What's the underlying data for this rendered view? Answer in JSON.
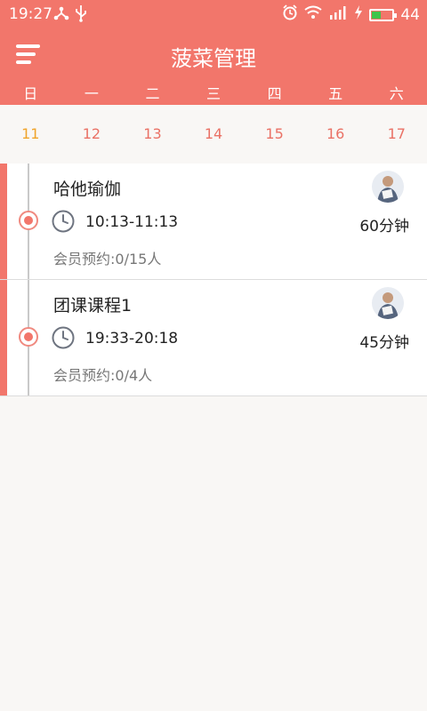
{
  "status_bar": {
    "time": "19:27",
    "battery_level_text": "44",
    "battery_fraction": 0.44,
    "icons": [
      "share-icon",
      "usb-icon",
      "alarm-icon",
      "wifi-icon",
      "signal-icon",
      "charging-icon",
      "battery-icon"
    ]
  },
  "header": {
    "title": "菠菜管理",
    "menu_icon": "menu-icon"
  },
  "calendar": {
    "weekdays": [
      "日",
      "一",
      "二",
      "三",
      "四",
      "五",
      "六"
    ],
    "dates": [
      "11",
      "12",
      "13",
      "14",
      "15",
      "16",
      "17"
    ],
    "today_index": 0
  },
  "classes": [
    {
      "name": "哈他瑜伽",
      "time_range": "10:13-11:13",
      "duration": "60分钟",
      "booking": "会员预约:0/15人"
    },
    {
      "name": "团课课程1",
      "time_range": "19:33-20:18",
      "duration": "45分钟",
      "booking": "会员预约:0/4人"
    }
  ],
  "colors": {
    "primary": "#f2766b",
    "today_date": "#f0a42a",
    "date_text": "#ea7165",
    "battery_fill": "#3ec44a"
  }
}
